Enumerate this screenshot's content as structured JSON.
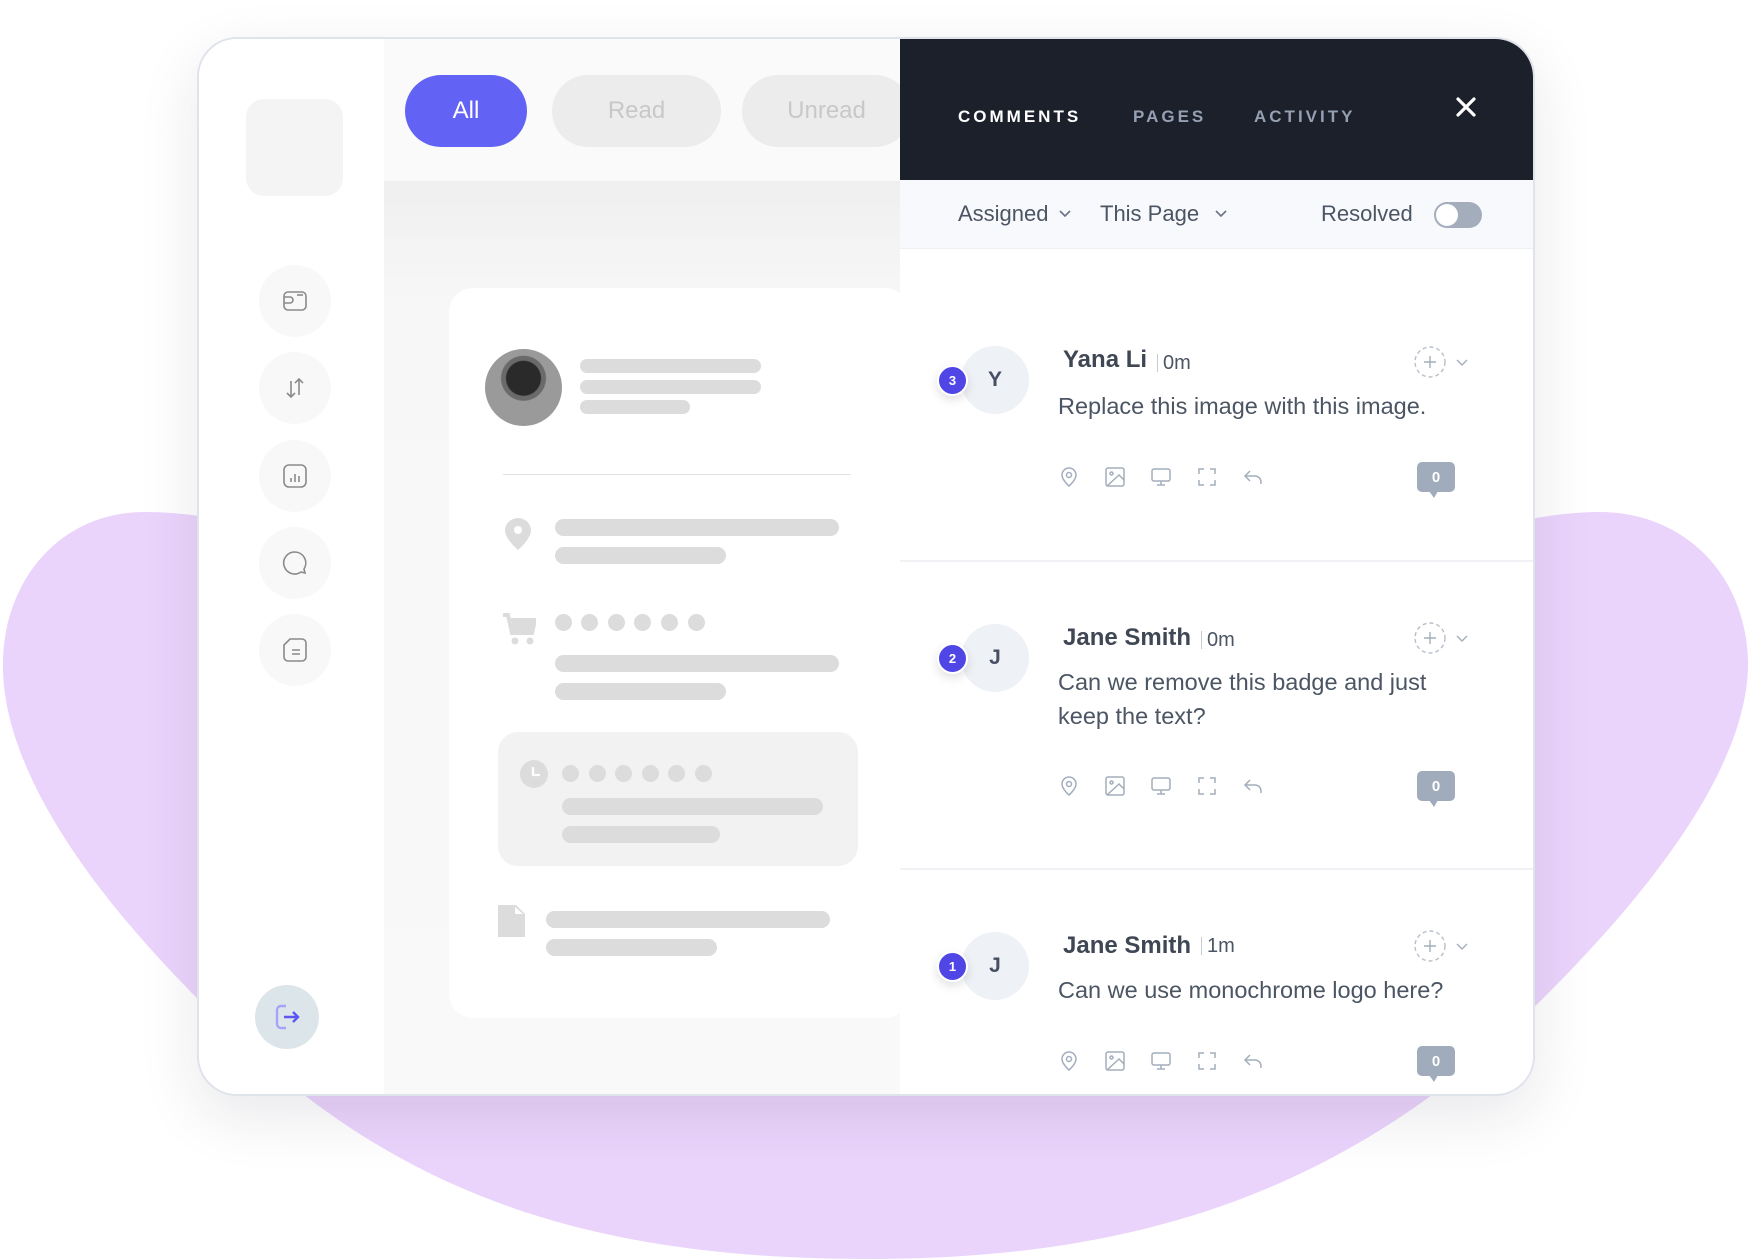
{
  "colors": {
    "accent": "#6262f5",
    "badge": "#4f46e5",
    "panel_header": "#1b202b",
    "blob": "#ebd4fc",
    "icon_gray": "#a3adbc"
  },
  "sidebar": {
    "items": [
      {
        "icon": "wallet-icon"
      },
      {
        "icon": "transfer-arrows-icon"
      },
      {
        "icon": "bar-chart-icon"
      },
      {
        "icon": "chat-bubble-icon"
      },
      {
        "icon": "document-icon"
      }
    ],
    "logout_icon": "logout-icon"
  },
  "filters": {
    "pills": [
      {
        "label": "All",
        "active": true
      },
      {
        "label": "Read",
        "active": false
      },
      {
        "label": "Unread",
        "active": false
      }
    ]
  },
  "panel": {
    "tabs": [
      {
        "label": "COMMENTS",
        "active": true
      },
      {
        "label": "PAGES",
        "active": false
      },
      {
        "label": "ACTIVITY",
        "active": false
      }
    ],
    "close_icon": "close-icon",
    "filter_bar": {
      "assigned_label": "Assigned",
      "page_label": "This Page",
      "resolved_label": "Resolved",
      "resolved_on": false
    },
    "comments": [
      {
        "number": "3",
        "initial": "Y",
        "author": "Yana Li",
        "time": "0m",
        "text": "Replace this image with this image.",
        "replies": "0"
      },
      {
        "number": "2",
        "initial": "J",
        "author": "Jane Smith",
        "time": "0m",
        "text": "Can we remove this badge and just keep the text?",
        "replies": "0"
      },
      {
        "number": "1",
        "initial": "J",
        "author": "Jane Smith",
        "time": "1m",
        "text": "Can we use monochrome logo here?",
        "replies": "0"
      }
    ]
  }
}
